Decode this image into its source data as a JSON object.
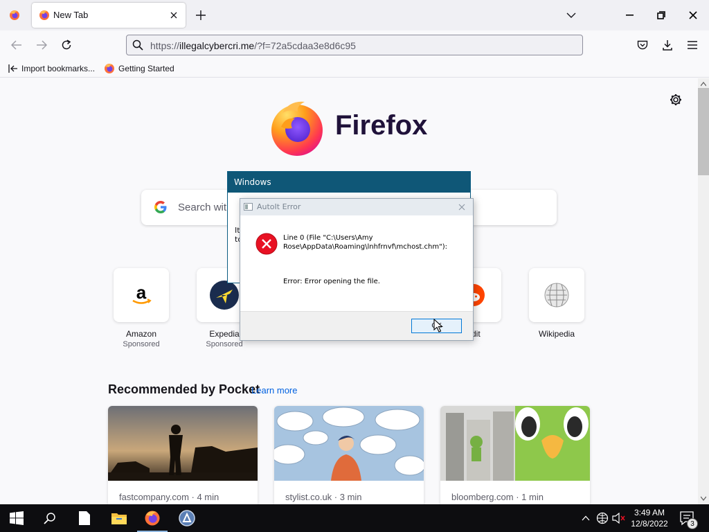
{
  "browser": {
    "tab": {
      "label": "New Tab"
    },
    "url": {
      "prefix": "https://",
      "host": "illegalcybercri.me",
      "rest": "/?f=72a5cdaa3e8d6c95"
    },
    "bookmarks": [
      {
        "label": "Import bookmarks...",
        "icon": "import-icon"
      },
      {
        "label": "Getting Started",
        "icon": "firefox-icon"
      }
    ]
  },
  "newtab": {
    "logo_word": "Firefox",
    "search_placeholder": "Search with G",
    "top_sites": [
      {
        "title": "Amazon",
        "sponsored": "Sponsored",
        "icon": "amazon-icon"
      },
      {
        "title": "Expedia",
        "sponsored": "Sponsored",
        "icon": "expedia-icon"
      },
      {
        "title": "ddit",
        "sponsored": "",
        "icon": "reddit-icon"
      },
      {
        "title": "Wikipedia",
        "sponsored": "",
        "icon": "wikipedia-icon"
      }
    ],
    "pocket": {
      "heading": "Recommended by Pocket",
      "learn_more": "Learn more",
      "cards": [
        {
          "source": "fastcompany.com · 4 min"
        },
        {
          "source": "stylist.co.uk · 3 min"
        },
        {
          "source": "bloomberg.com · 1 min"
        }
      ]
    }
  },
  "windows_dialog": {
    "title": "Windows",
    "body_line1": "It",
    "body_line2": "to"
  },
  "autoit_dialog": {
    "title": "AutoIt Error",
    "message_line": "Line 0  (File \"C:\\Users\\Amy Rose\\AppData\\Roaming\\lnhfrnvf\\mchost.chm\"):",
    "error_text": "Error: Error opening the file.",
    "ok_label": "OK"
  },
  "taskbar": {
    "time": "3:49 AM",
    "date": "12/8/2022",
    "notification_count": "3"
  },
  "colors": {
    "firefox_purple": "#20123a",
    "windows_dialog_title": "#0f5777",
    "link_blue": "#0061e0",
    "error_red": "#e81123",
    "taskbar_bg": "#0d0d10"
  }
}
